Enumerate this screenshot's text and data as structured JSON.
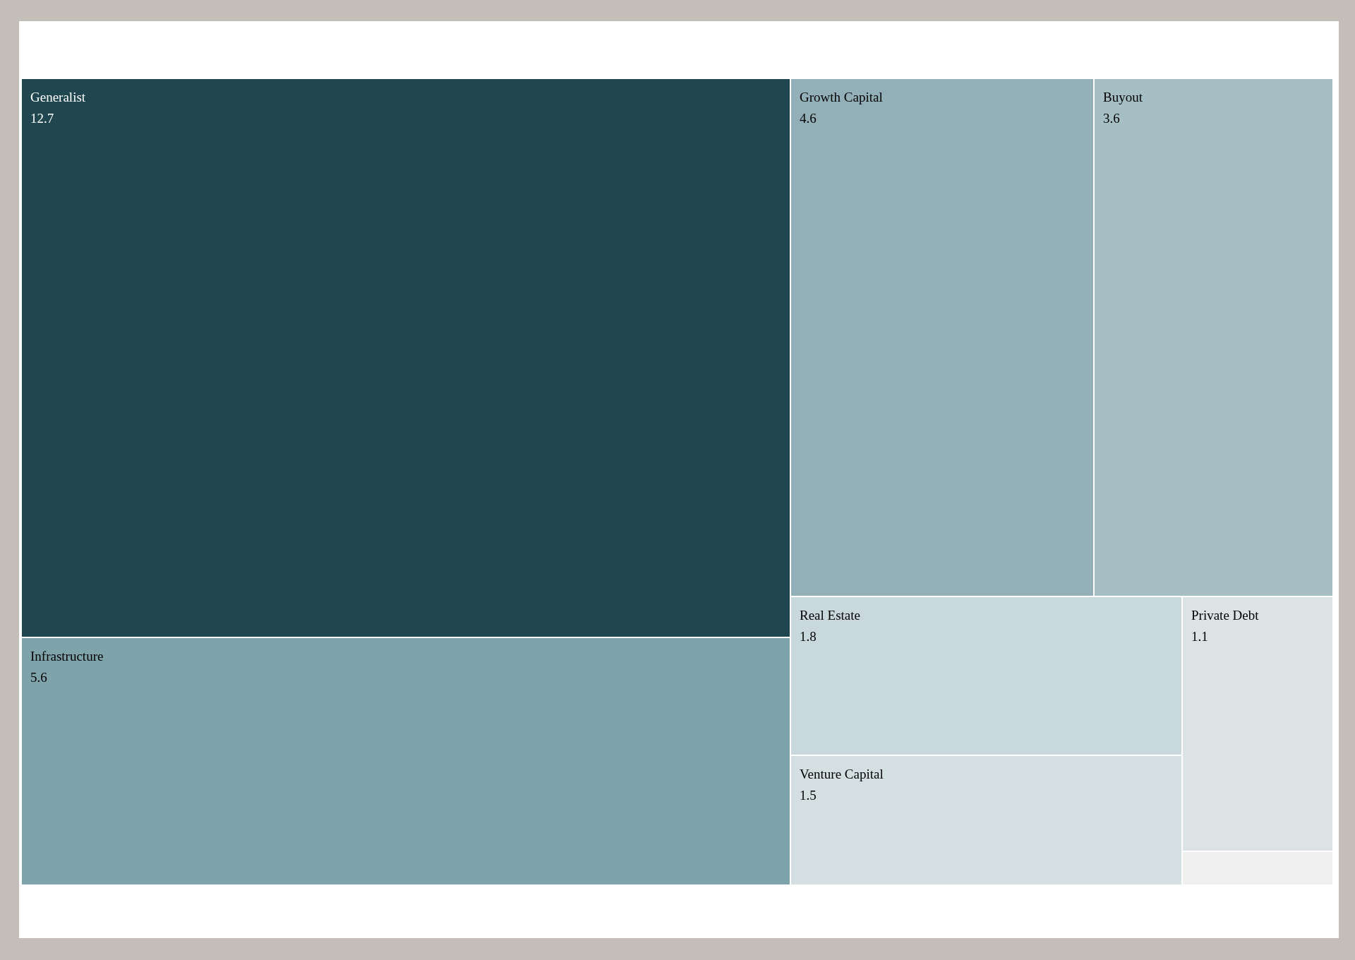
{
  "treemap": {
    "tiles": [
      {
        "label": "Generalist",
        "value": "12.7",
        "color": "#20464f"
      },
      {
        "label": "Infrastructure",
        "value": "5.6",
        "color": "#7fa3ab"
      },
      {
        "label": "Growth Capital",
        "value": "4.6",
        "color": "#93b0b8"
      },
      {
        "label": "Buyout",
        "value": "3.6",
        "color": "#a6bfc4"
      },
      {
        "label": "Real Estate",
        "value": "1.8",
        "color": "#c8d8dc"
      },
      {
        "label": "Venture Capital",
        "value": "1.5",
        "color": "#d3dfe0"
      },
      {
        "label": "Private Debt",
        "value": "1.1",
        "color": "#dbe3e4"
      }
    ]
  }
}
